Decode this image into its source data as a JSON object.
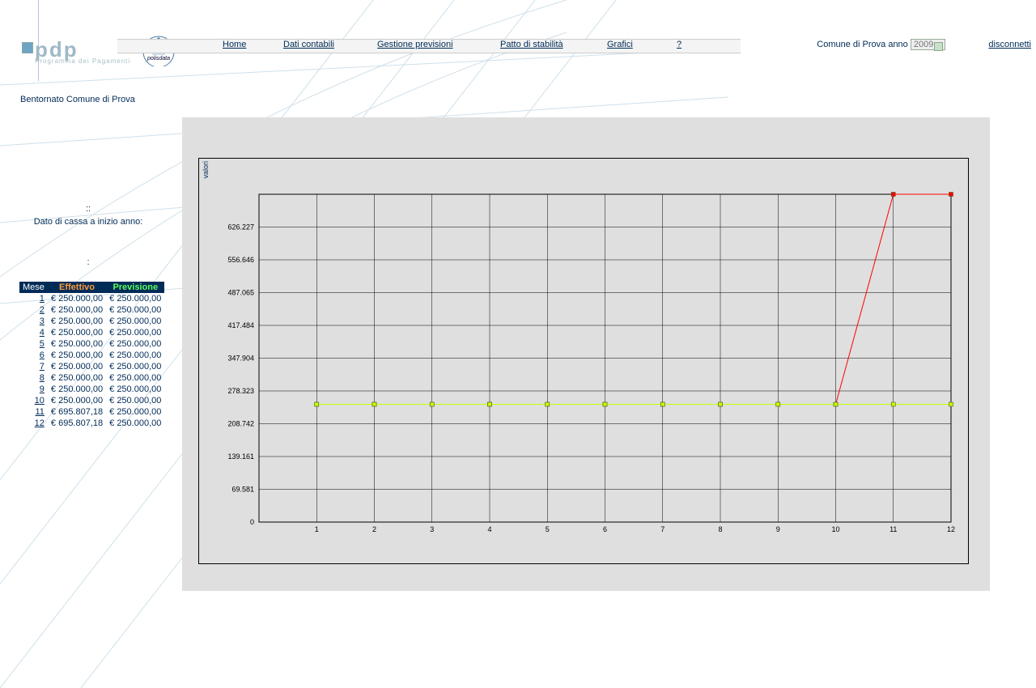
{
  "header": {
    "logo_main": "pdp",
    "logo_sub": "Programma dei Pagamenti",
    "polis_logo_label": "polisdata",
    "nav": {
      "home": "Home",
      "dati": "Dati contabili",
      "gestione": "Gestione previsioni",
      "patto": "Patto di stabilità",
      "grafici": "Grafici",
      "help": "?"
    },
    "comune_label": "Comune  di Prova  anno",
    "year": "2009",
    "disconnect": "disconnetti"
  },
  "welcome": "Bentornato Comune  di Prova",
  "side": {
    "dots1": "::",
    "cassa": "Dato di cassa a inizio anno:",
    "colon": ":"
  },
  "table": {
    "col_mese": "Mese",
    "col_eff": "Effettivo",
    "col_prev": "Previsione",
    "rows": [
      {
        "m": "1",
        "eff": "€ 250.000,00",
        "prev": "€ 250.000,00"
      },
      {
        "m": "2",
        "eff": "€ 250.000,00",
        "prev": "€ 250.000,00"
      },
      {
        "m": "3",
        "eff": "€ 250.000,00",
        "prev": "€ 250.000,00"
      },
      {
        "m": "4",
        "eff": "€ 250.000,00",
        "prev": "€ 250.000,00"
      },
      {
        "m": "5",
        "eff": "€ 250.000,00",
        "prev": "€ 250.000,00"
      },
      {
        "m": "6",
        "eff": "€ 250.000,00",
        "prev": "€ 250.000,00"
      },
      {
        "m": "7",
        "eff": "€ 250.000,00",
        "prev": "€ 250.000,00"
      },
      {
        "m": "8",
        "eff": "€ 250.000,00",
        "prev": "€ 250.000,00"
      },
      {
        "m": "9",
        "eff": "€ 250.000,00",
        "prev": "€ 250.000,00"
      },
      {
        "m": "10",
        "eff": "€ 250.000,00",
        "prev": "€ 250.000,00"
      },
      {
        "m": "11",
        "eff": "€ 695.807,18",
        "prev": "€ 250.000,00"
      },
      {
        "m": "12",
        "eff": "€ 695.807,18",
        "prev": "€ 250.000,00"
      }
    ]
  },
  "chart": {
    "y_label": "valori",
    "y_ticks": [
      "626.227",
      "556.646",
      "487.065",
      "417.484",
      "347.904",
      "278.323",
      "208.742",
      "139.161",
      "69.581",
      "0"
    ],
    "x_ticks": [
      "1",
      "2",
      "3",
      "4",
      "5",
      "6",
      "7",
      "8",
      "9",
      "10",
      "11",
      "12"
    ]
  },
  "chart_data": {
    "type": "line",
    "xlabel": "",
    "ylabel": "valori",
    "x": [
      1,
      2,
      3,
      4,
      5,
      6,
      7,
      8,
      9,
      10,
      11,
      12
    ],
    "xlim": [
      0,
      12
    ],
    "ylim": [
      0,
      695808
    ],
    "series": [
      {
        "name": "Effettivo",
        "color": "#ff0000",
        "values": [
          250000,
          250000,
          250000,
          250000,
          250000,
          250000,
          250000,
          250000,
          250000,
          250000,
          695807.18,
          695807.18
        ]
      },
      {
        "name": "Previsione",
        "color": "#c4ff00",
        "values": [
          250000,
          250000,
          250000,
          250000,
          250000,
          250000,
          250000,
          250000,
          250000,
          250000,
          250000,
          250000
        ]
      }
    ],
    "y_ticks": [
      0,
      69581,
      139161,
      208742,
      278323,
      347904,
      417484,
      487065,
      556646,
      626227
    ]
  }
}
